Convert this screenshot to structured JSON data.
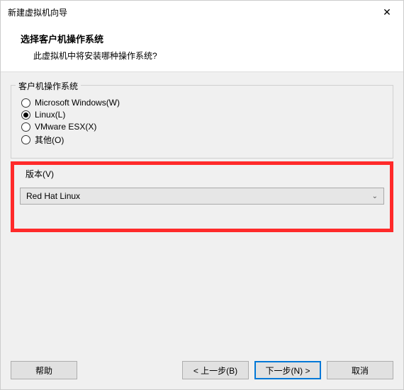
{
  "window": {
    "title": "新建虚拟机向导",
    "close_glyph": "✕"
  },
  "header": {
    "title": "选择客户机操作系统",
    "subtitle": "此虚拟机中将安装哪种操作系统?"
  },
  "os_group": {
    "label": "客户机操作系统",
    "options": [
      {
        "label": "Microsoft Windows(W)",
        "checked": false
      },
      {
        "label": "Linux(L)",
        "checked": true
      },
      {
        "label": "VMware ESX(X)",
        "checked": false
      },
      {
        "label": "其他(O)",
        "checked": false
      }
    ]
  },
  "version": {
    "label": "版本(V)",
    "selected": "Red Hat Linux"
  },
  "footer": {
    "help": "帮助",
    "back": "< 上一步(B)",
    "next": "下一步(N) >",
    "cancel": "取消"
  }
}
